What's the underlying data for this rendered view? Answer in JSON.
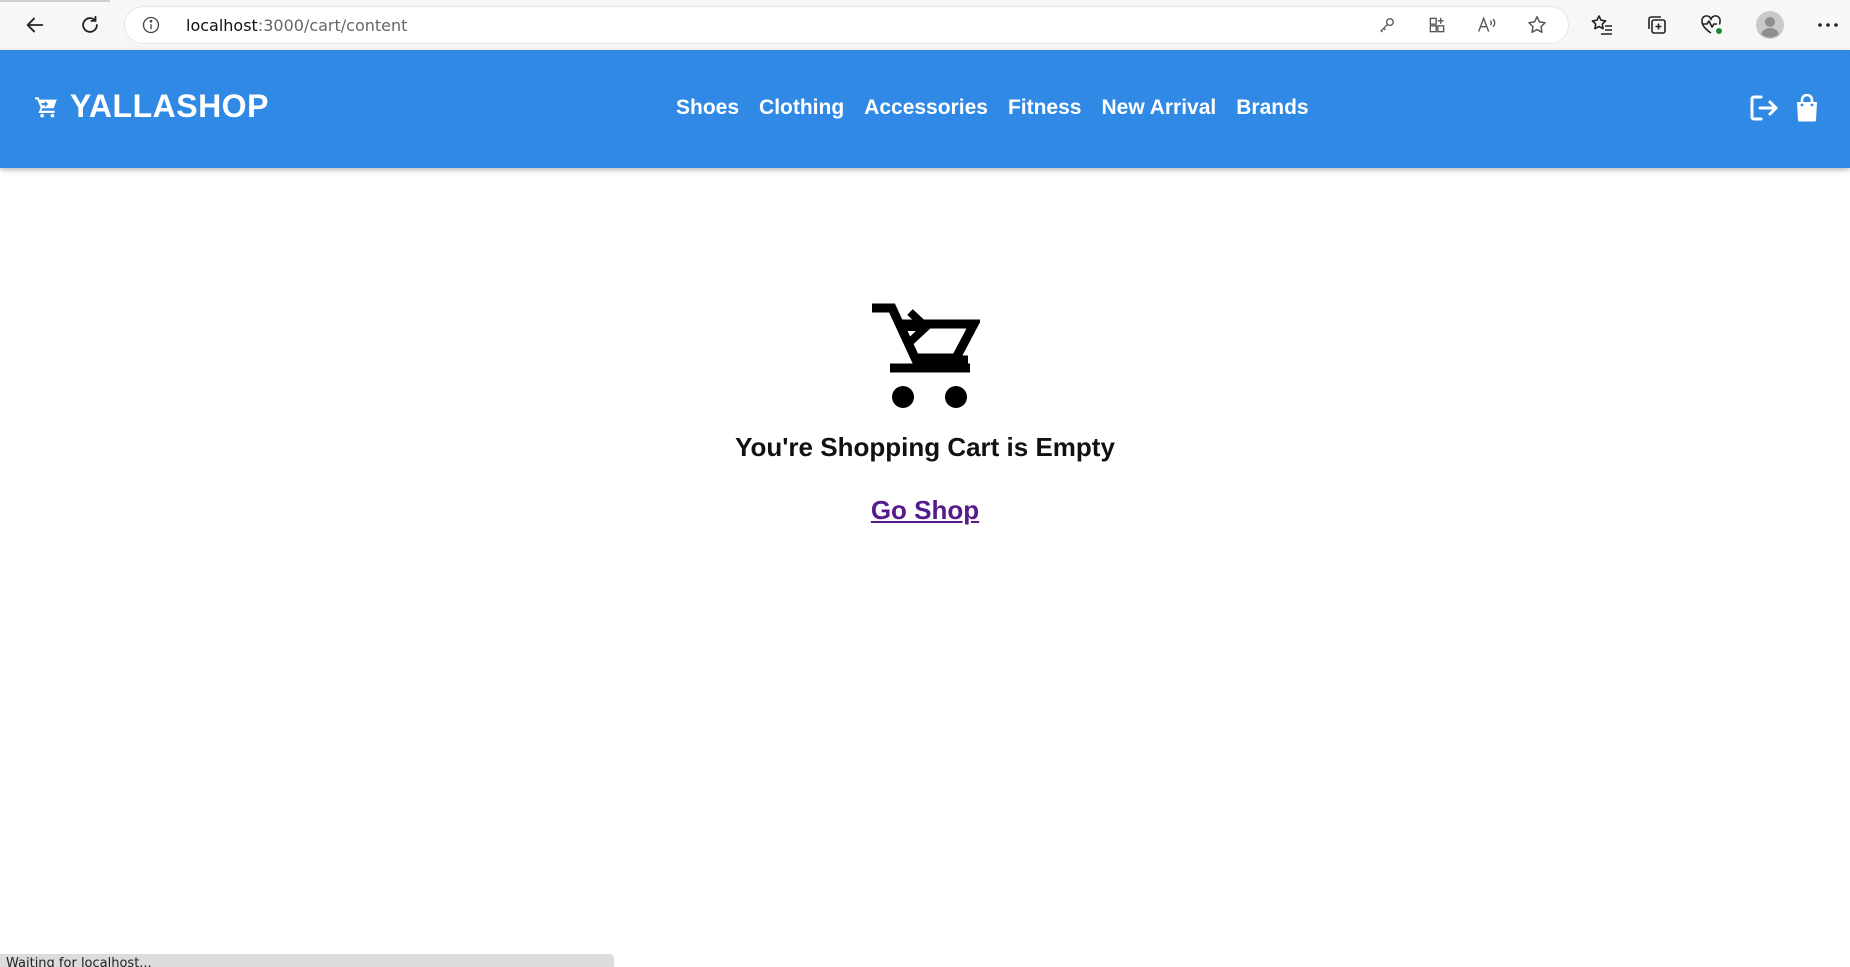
{
  "browser": {
    "url_host": "localhost",
    "url_path": ":3000/cart/content",
    "status_text": "Waiting for localhost..."
  },
  "header": {
    "brand_name": "YALLASHOP",
    "brand_icon": "cart-icon",
    "nav": [
      {
        "label": "Shoes"
      },
      {
        "label": "Clothing"
      },
      {
        "label": "Accessories"
      },
      {
        "label": "Fitness"
      },
      {
        "label": "New Arrival"
      },
      {
        "label": "Brands"
      }
    ],
    "icons": [
      "logout-icon",
      "shopping-bag-icon"
    ],
    "background_color": "#308ae5"
  },
  "main": {
    "empty_icon": "add-shopping-cart-icon",
    "empty_message": "You're Shopping Cart is Empty",
    "go_shop_label": "Go Shop",
    "link_color": "#551a8b"
  }
}
